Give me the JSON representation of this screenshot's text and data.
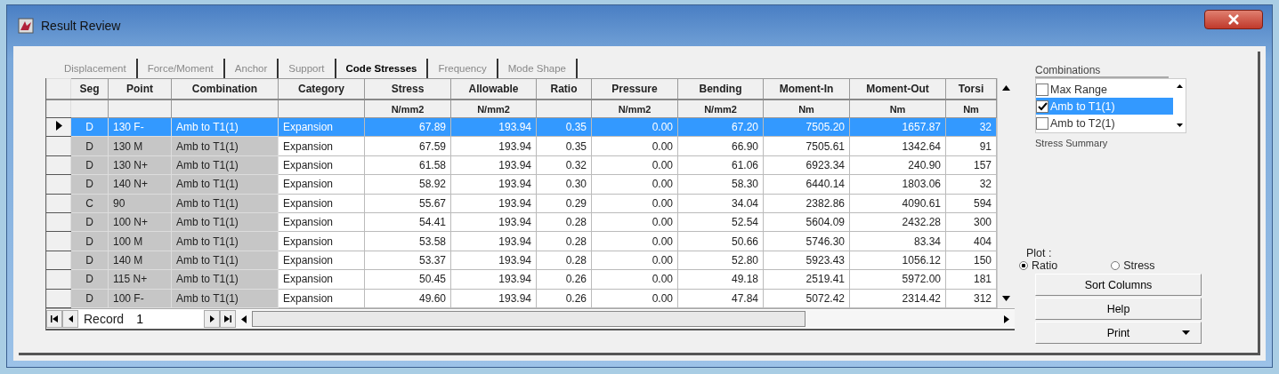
{
  "window": {
    "title": "Result Review"
  },
  "tabs": [
    {
      "label": "Displacement",
      "selected": false
    },
    {
      "label": "Force/Moment",
      "selected": false
    },
    {
      "label": "Anchor",
      "selected": false
    },
    {
      "label": "Support",
      "selected": false
    },
    {
      "label": "Code Stresses",
      "selected": true
    },
    {
      "label": "Frequency",
      "selected": false
    },
    {
      "label": "Mode Shape",
      "selected": false
    }
  ],
  "table": {
    "columns": [
      {
        "label": "Seg"
      },
      {
        "label": "Point"
      },
      {
        "label": "Combination"
      },
      {
        "label": "Category"
      },
      {
        "label": "Stress",
        "unit": "N/mm2"
      },
      {
        "label": "Allowable",
        "unit": "N/mm2"
      },
      {
        "label": "Ratio"
      },
      {
        "label": "Pressure",
        "unit": "N/mm2"
      },
      {
        "label": "Bending",
        "unit": "N/mm2"
      },
      {
        "label": "Moment-In",
        "unit": "Nm"
      },
      {
        "label": "Moment-Out",
        "unit": "Nm"
      },
      {
        "label": "Torsi",
        "unit": "Nm"
      }
    ],
    "rows": [
      {
        "selected": true,
        "cells": [
          "D",
          "130 F-",
          "Amb to T1(1)",
          "Expansion",
          "67.89",
          "193.94",
          "0.35",
          "0.00",
          "67.20",
          "7505.20",
          "1657.87",
          "32"
        ]
      },
      {
        "selected": false,
        "cells": [
          "D",
          "130 M",
          "Amb to T1(1)",
          "Expansion",
          "67.59",
          "193.94",
          "0.35",
          "0.00",
          "66.90",
          "7505.61",
          "1342.64",
          "91"
        ]
      },
      {
        "selected": false,
        "cells": [
          "D",
          "130 N+",
          "Amb to T1(1)",
          "Expansion",
          "61.58",
          "193.94",
          "0.32",
          "0.00",
          "61.06",
          "6923.34",
          "240.90",
          "157"
        ]
      },
      {
        "selected": false,
        "cells": [
          "D",
          "140 N+",
          "Amb to T1(1)",
          "Expansion",
          "58.92",
          "193.94",
          "0.30",
          "0.00",
          "58.30",
          "6440.14",
          "1803.06",
          "32"
        ]
      },
      {
        "selected": false,
        "cells": [
          "C",
          "90",
          "Amb to T1(1)",
          "Expansion",
          "55.67",
          "193.94",
          "0.29",
          "0.00",
          "34.04",
          "2382.86",
          "4090.61",
          "594"
        ]
      },
      {
        "selected": false,
        "cells": [
          "D",
          "100 N+",
          "Amb to T1(1)",
          "Expansion",
          "54.41",
          "193.94",
          "0.28",
          "0.00",
          "52.54",
          "5604.09",
          "2432.28",
          "300"
        ]
      },
      {
        "selected": false,
        "cells": [
          "D",
          "100 M",
          "Amb to T1(1)",
          "Expansion",
          "53.58",
          "193.94",
          "0.28",
          "0.00",
          "50.66",
          "5746.30",
          "83.34",
          "404"
        ]
      },
      {
        "selected": false,
        "cells": [
          "D",
          "140 M",
          "Amb to T1(1)",
          "Expansion",
          "53.37",
          "193.94",
          "0.28",
          "0.00",
          "52.80",
          "5923.43",
          "1056.12",
          "150"
        ]
      },
      {
        "selected": false,
        "cells": [
          "D",
          "115 N+",
          "Amb to T1(1)",
          "Expansion",
          "50.45",
          "193.94",
          "0.26",
          "0.00",
          "49.18",
          "2519.41",
          "5972.00",
          "181"
        ]
      },
      {
        "selected": false,
        "cells": [
          "D",
          "100 F-",
          "Amb to T1(1)",
          "Expansion",
          "49.60",
          "193.94",
          "0.26",
          "0.00",
          "47.84",
          "5072.42",
          "2314.42",
          "312"
        ]
      }
    ]
  },
  "record": {
    "label": "Record",
    "value": "1"
  },
  "combinations": {
    "label": "Combinations",
    "items": [
      {
        "label": "Max Range",
        "checked": false,
        "selected": false
      },
      {
        "label": "Amb to T1(1)",
        "checked": true,
        "selected": true
      },
      {
        "label": "Amb to T2(1)",
        "checked": false,
        "selected": false
      }
    ]
  },
  "stress_summary": {
    "label": "Stress Summary"
  },
  "plot": {
    "label": "Plot :",
    "options": [
      {
        "label": "Ratio",
        "selected": true
      },
      {
        "label": "Stress",
        "selected": false
      }
    ]
  },
  "buttons": [
    {
      "label": "Sort Columns",
      "kind": "plain"
    },
    {
      "label": "Help",
      "kind": "plain"
    },
    {
      "label": "Print",
      "kind": "dropdown"
    }
  ]
}
